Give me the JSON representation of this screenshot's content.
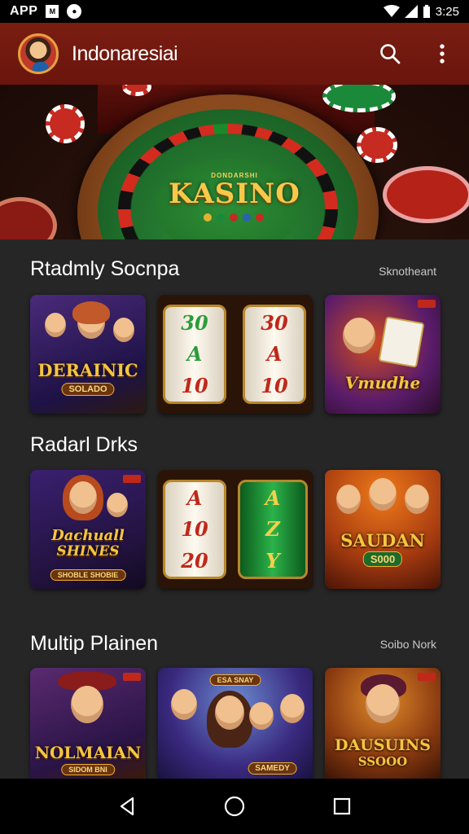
{
  "status_bar": {
    "app_label": "APP",
    "box_glyph": "M",
    "time": "3:25"
  },
  "app_bar": {
    "title": "Indonaresiai"
  },
  "hero": {
    "subtitle": "DONDARSHI",
    "title": "KASINO"
  },
  "sections": [
    {
      "title": "Rtadmly Socnpa",
      "link": "Sknotheant",
      "tiles": [
        {
          "label": "DERAINIC",
          "sub": "SOLADO"
        },
        {
          "reels": [
            [
              "30",
              "A",
              "10"
            ],
            [
              "30",
              "A",
              "10"
            ]
          ]
        },
        {
          "label": "Vmudhe"
        }
      ]
    },
    {
      "title": "Radarl Drks",
      "tiles": [
        {
          "label": "Dachuall",
          "label2": "SHINES",
          "sub": "SHOBLE SHOBIE"
        },
        {
          "reels": [
            [
              "A",
              "10",
              "20"
            ],
            [
              "A",
              "Z",
              "Y"
            ]
          ]
        },
        {
          "label": "SAUDAN",
          "sub": "S000"
        }
      ]
    },
    {
      "title": "Multip Plainen",
      "link": "Soibo  Nork",
      "tiles": [
        {
          "label": "NOLMAIAN",
          "sub": "SIDOM BNI"
        },
        {
          "badge": "ESA SNAY",
          "label": "SAMEDY"
        },
        {
          "label": "DAUSUINS",
          "sub": "SSOOO"
        }
      ]
    }
  ],
  "icons": [
    "avatar",
    "search-icon",
    "more-vert-icon",
    "back-icon",
    "home-icon",
    "recents-icon",
    "wifi-icon",
    "signal-icon",
    "battery-icon"
  ]
}
